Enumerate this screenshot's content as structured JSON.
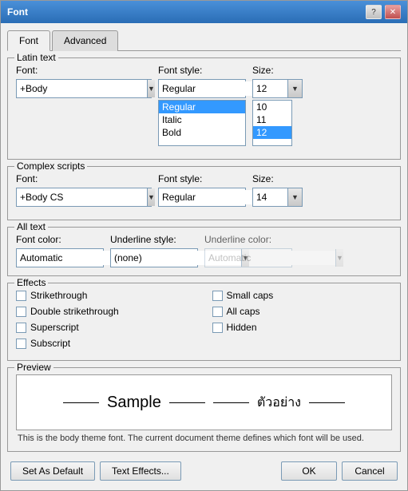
{
  "window": {
    "title": "Font",
    "controls": {
      "help": "?",
      "close": "✕"
    }
  },
  "tabs": [
    {
      "id": "font",
      "label": "Font",
      "active": true
    },
    {
      "id": "advanced",
      "label": "Advanced",
      "active": false
    }
  ],
  "latin_text": {
    "section_label": "Latin text",
    "font_label": "Font:",
    "font_value": "+Body",
    "style_label": "Font style:",
    "style_value": "Regular",
    "style_options": [
      "Regular",
      "Italic",
      "Bold"
    ],
    "style_selected": "Regular",
    "size_label": "Size:",
    "size_value": "12",
    "size_options": [
      "10",
      "11",
      "12"
    ],
    "size_selected": "12"
  },
  "complex_scripts": {
    "section_label": "Complex scripts",
    "font_label": "Font:",
    "font_value": "+Body CS",
    "style_label": "Font style:",
    "style_value": "Regular",
    "size_label": "Size:",
    "size_value": "14"
  },
  "all_text": {
    "section_label": "All text",
    "font_color_label": "Font color:",
    "font_color_value": "Automatic",
    "underline_style_label": "Underline style:",
    "underline_style_value": "(none)",
    "underline_color_label": "Underline color:",
    "underline_color_value": "Automatic"
  },
  "effects": {
    "section_label": "Effects",
    "checkboxes_left": [
      {
        "id": "strikethrough",
        "label": "Strikethrough",
        "checked": false
      },
      {
        "id": "double_strikethrough",
        "label": "Double strikethrough",
        "checked": false
      },
      {
        "id": "superscript",
        "label": "Superscript",
        "checked": false
      },
      {
        "id": "subscript",
        "label": "Subscript",
        "checked": false
      }
    ],
    "checkboxes_right": [
      {
        "id": "small_caps",
        "label": "Small caps",
        "checked": false
      },
      {
        "id": "all_caps",
        "label": "All caps",
        "checked": false
      },
      {
        "id": "hidden",
        "label": "Hidden",
        "checked": false
      }
    ]
  },
  "preview": {
    "section_label": "Preview",
    "sample_text": "Sample",
    "thai_text": "ตัวอย่าง",
    "description": "This is the body theme font. The current document theme defines which font will be used."
  },
  "footer": {
    "set_default_label": "Set As Default",
    "text_effects_label": "Text Effects...",
    "ok_label": "OK",
    "cancel_label": "Cancel"
  }
}
